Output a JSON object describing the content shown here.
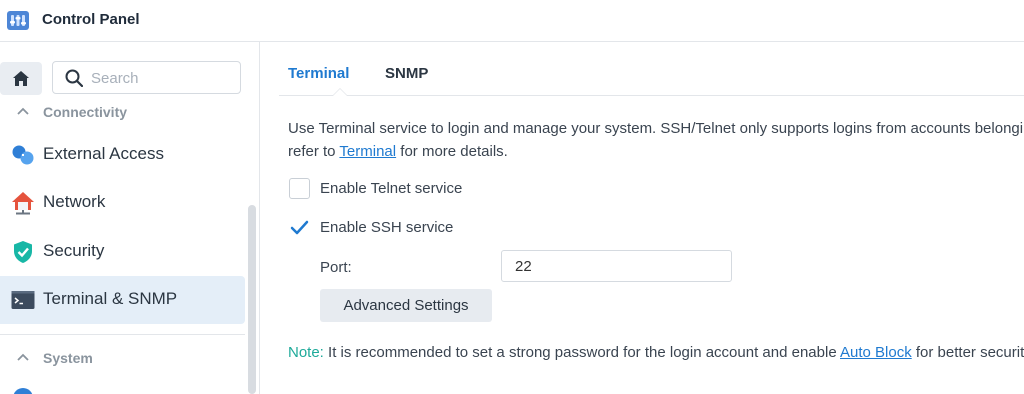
{
  "window": {
    "title": "Control Panel",
    "icon": "control-panel-app-icon"
  },
  "sidebar": {
    "search": {
      "placeholder": "Search"
    },
    "sections": [
      {
        "label": "Connectivity",
        "expanded": true
      },
      {
        "label": "System",
        "expanded": true
      }
    ],
    "items": [
      {
        "label": "External Access",
        "icon": "external-access-icon",
        "selected": false
      },
      {
        "label": "Network",
        "icon": "network-house-icon",
        "selected": false
      },
      {
        "label": "Security",
        "icon": "shield-check-icon",
        "selected": false
      },
      {
        "label": "Terminal & SNMP",
        "icon": "terminal-icon",
        "selected": true
      }
    ]
  },
  "main": {
    "tabs": [
      {
        "label": "Terminal",
        "active": true
      },
      {
        "label": "SNMP",
        "active": false
      }
    ],
    "description": {
      "line1": "Use Terminal service to login and manage your system. SSH/Telnet only supports logins from accounts belonging to the administrators group. Please",
      "line2_before": "refer to ",
      "line2_link": "Terminal",
      "line2_after": " for more details."
    },
    "telnet": {
      "label": "Enable Telnet service",
      "checked": false
    },
    "ssh": {
      "label": "Enable SSH service",
      "checked": true
    },
    "port": {
      "label": "Port:",
      "value": "22"
    },
    "advanced_button": "Advanced Settings",
    "note": {
      "prefix": "Note:",
      "text_before": " It is recommended to set a strong password for the login account and enable ",
      "link": "Auto Block",
      "text_after": " for better security."
    }
  },
  "colors": {
    "accent": "#1f7ad0",
    "note": "#1eaa9a",
    "selected_bg": "#e4eef8",
    "checkbox_checked": "#1f7ad0"
  }
}
